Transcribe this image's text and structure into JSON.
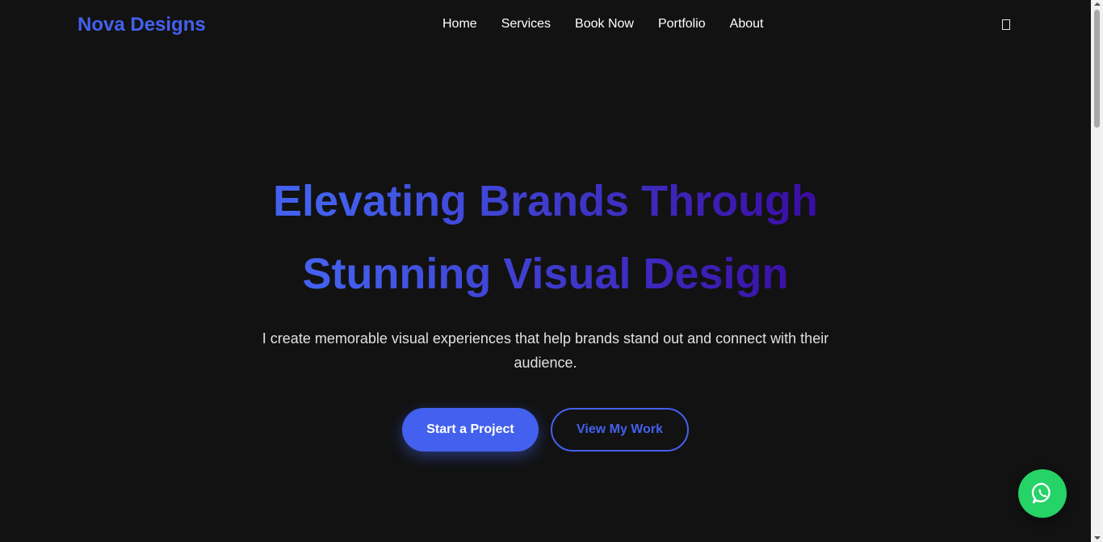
{
  "brand": {
    "name": "Nova Designs"
  },
  "nav": {
    "items": [
      {
        "label": "Home"
      },
      {
        "label": "Services"
      },
      {
        "label": "Book Now"
      },
      {
        "label": "Portfolio"
      },
      {
        "label": "About"
      }
    ],
    "theme_toggle_icon": "theme-toggle-icon"
  },
  "hero": {
    "title_line1": "Elevating Brands Through",
    "title_line2": "Stunning Visual Design",
    "subtitle": "I create memorable visual experiences that help brands stand out and connect with their audience.",
    "primary_cta": "Start a Project",
    "secondary_cta": "View My Work"
  },
  "floating": {
    "icon": "whatsapp-icon"
  },
  "colors": {
    "background": "#121212",
    "accent": "#4361ee",
    "accent_dark": "#3a0ca3",
    "whatsapp": "#25d366",
    "text": "#ffffff"
  }
}
